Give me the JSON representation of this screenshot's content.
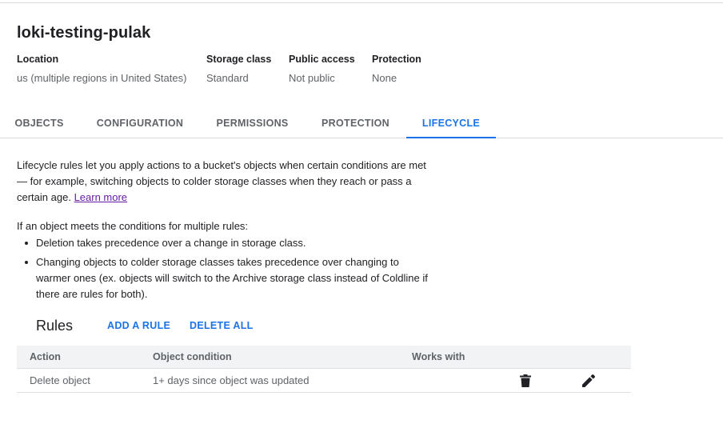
{
  "bucket": {
    "name": "loki-testing-pulak",
    "meta": [
      {
        "label": "Location",
        "value": "us (multiple regions in United States)"
      },
      {
        "label": "Storage class",
        "value": "Standard"
      },
      {
        "label": "Public access",
        "value": "Not public"
      },
      {
        "label": "Protection",
        "value": "None"
      }
    ]
  },
  "tabs": [
    {
      "label": "OBJECTS",
      "active": false
    },
    {
      "label": "CONFIGURATION",
      "active": false
    },
    {
      "label": "PERMISSIONS",
      "active": false
    },
    {
      "label": "PROTECTION",
      "active": false
    },
    {
      "label": "LIFECYCLE",
      "active": true
    }
  ],
  "intro": {
    "text": "Lifecycle rules let you apply actions to a bucket's objects when certain conditions are met — for example, switching objects to colder storage classes when they reach or pass a certain age.",
    "learn_more": "Learn more"
  },
  "conditions": {
    "lead": "If an object meets the conditions for multiple rules:",
    "bullets": [
      "Deletion takes precedence over a change in storage class.",
      "Changing objects to colder storage classes takes precedence over changing to warmer ones (ex. objects will switch to the Archive storage class instead of Coldline if there are rules for both)."
    ]
  },
  "rules": {
    "heading": "Rules",
    "add_label": "ADD A RULE",
    "delete_all_label": "DELETE ALL",
    "columns": [
      "Action",
      "Object condition",
      "Works with"
    ],
    "rows": [
      {
        "action": "Delete object",
        "condition": "1+ days since object was updated",
        "works_with": ""
      }
    ]
  },
  "icons": {
    "delete": "trash-icon",
    "edit": "pencil-icon"
  },
  "colors": {
    "accent": "#1a73e8",
    "link_visited": "#681da8",
    "text": "#202124",
    "muted": "#5f6368"
  }
}
